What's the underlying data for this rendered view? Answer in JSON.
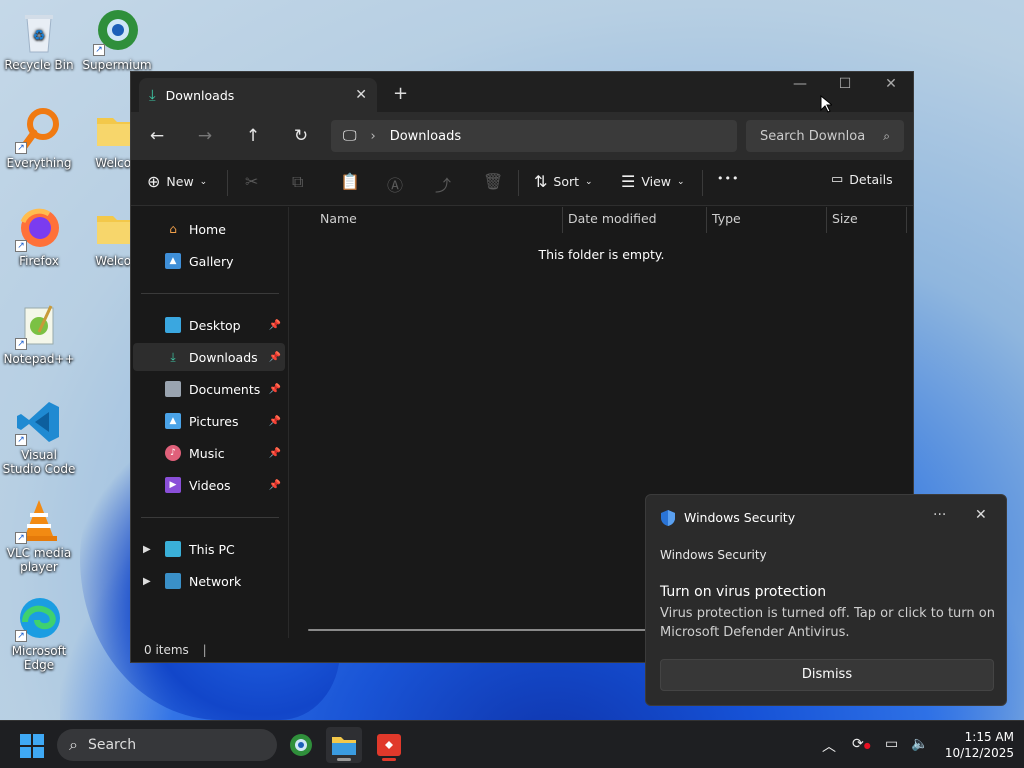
{
  "desktop": {
    "icons": [
      {
        "label": "Recycle Bin",
        "icon": "recycle-bin-icon"
      },
      {
        "label": "Supermium",
        "icon": "supermium-icon"
      },
      {
        "label": "Everything",
        "icon": "everything-search-icon"
      },
      {
        "label": "Welcon",
        "icon": "folder-icon"
      },
      {
        "label": "Firefox",
        "icon": "firefox-icon"
      },
      {
        "label": "Welcon",
        "icon": "folder-icon"
      },
      {
        "label": "Notepad++",
        "icon": "notepad-plus-plus-icon"
      },
      {
        "label": "Visual Studio Code",
        "icon": "vscode-icon"
      },
      {
        "label": "VLC media player",
        "icon": "vlc-icon"
      },
      {
        "label": "Microsoft Edge",
        "icon": "edge-icon"
      }
    ]
  },
  "explorer": {
    "tab_title": "Downloads",
    "new_tab": "+",
    "address": {
      "path": "Downloads"
    },
    "search": {
      "placeholder": "Search Downloa"
    },
    "toolbar": {
      "new_label": "New",
      "sort_label": "Sort",
      "view_label": "View",
      "more_label": "•••",
      "details_label": "Details"
    },
    "sidebar": {
      "top": [
        {
          "label": "Home",
          "icon": "home-icon"
        },
        {
          "label": "Gallery",
          "icon": "gallery-icon"
        }
      ],
      "pinned": [
        {
          "label": "Desktop",
          "icon": "desktop-folder-icon"
        },
        {
          "label": "Downloads",
          "icon": "downloads-folder-icon",
          "selected": true
        },
        {
          "label": "Documents",
          "icon": "documents-folder-icon"
        },
        {
          "label": "Pictures",
          "icon": "pictures-folder-icon"
        },
        {
          "label": "Music",
          "icon": "music-folder-icon"
        },
        {
          "label": "Videos",
          "icon": "videos-folder-icon"
        }
      ],
      "bottom": [
        {
          "label": "This PC",
          "icon": "this-pc-icon"
        },
        {
          "label": "Network",
          "icon": "network-icon"
        }
      ]
    },
    "columns": [
      "Name",
      "Date modified",
      "Type",
      "Size"
    ],
    "empty_message": "This folder is empty.",
    "status": "0 items"
  },
  "toast": {
    "app_name": "Windows Security",
    "source": "Windows Security",
    "title": "Turn on virus protection",
    "body": "Virus protection is turned off. Tap or click to turn on Microsoft Defender Antivirus.",
    "dismiss_label": "Dismiss",
    "more_label": "···",
    "close_label": "✕"
  },
  "taskbar": {
    "search_placeholder": "Search",
    "time": "1:15 AM",
    "date": "10/12/2025"
  },
  "colors": {
    "accent": "#60cdff",
    "window_bg": "#191919",
    "taskbar_bg": "#1e1f22"
  }
}
